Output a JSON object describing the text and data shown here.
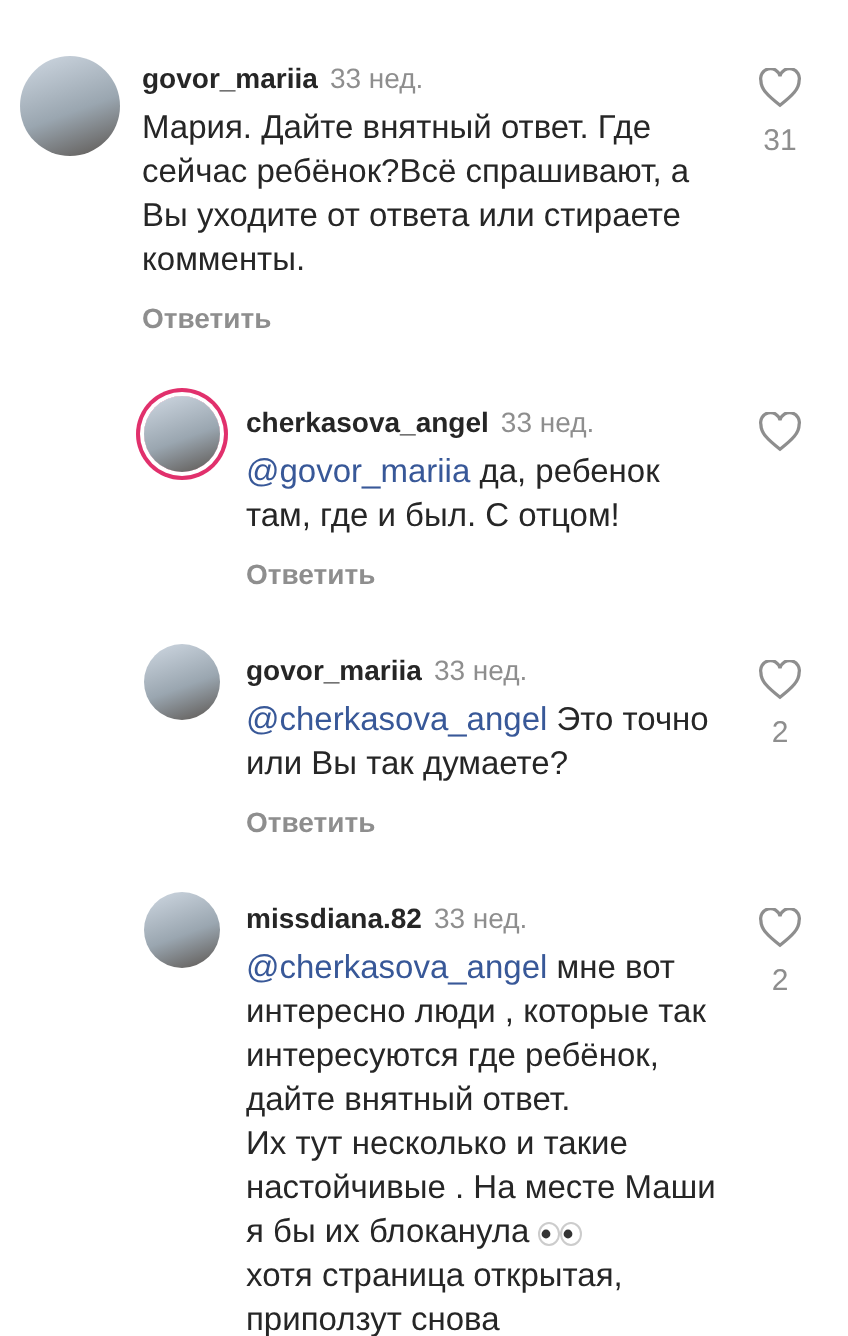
{
  "comments": [
    {
      "username": "govor_mariia",
      "time": "33 нед.",
      "story_ring": false,
      "reply": false,
      "segments": [
        {
          "kind": "text",
          "text": "Мария. Дайте внятный ответ. Где сейчас ребёнок?Всё спрашивают, а Вы уходите от ответа или стираете комменты."
        }
      ],
      "likes": "31",
      "action": "Ответить"
    },
    {
      "username": "cherkasova_angel",
      "time": "33 нед.",
      "story_ring": true,
      "reply": true,
      "segments": [
        {
          "kind": "mention",
          "text": "@govor_mariia"
        },
        {
          "kind": "text",
          "text": " да, ребенок там, где и был. С отцом!"
        }
      ],
      "action": "Ответить"
    },
    {
      "username": "govor_mariia",
      "time": "33 нед.",
      "story_ring": false,
      "reply": true,
      "segments": [
        {
          "kind": "mention",
          "text": "@cherkasova_angel"
        },
        {
          "kind": "text",
          "text": " Это точно или Вы так думаете?"
        }
      ],
      "likes": "2",
      "action": "Ответить"
    },
    {
      "username": "missdiana.82",
      "time": "33 нед.",
      "story_ring": false,
      "reply": true,
      "segments": [
        {
          "kind": "mention",
          "text": "@cherkasova_angel"
        },
        {
          "kind": "text",
          "text": " мне вот интересно люди , которые так интересуются где ребёнок, дайте  внятный ответ.\nИх тут несколько и такие настойчивые . На месте Маши я бы их блоканула "
        },
        {
          "kind": "emoji"
        },
        {
          "kind": "text",
          "text": "\nхотя страница открытая, приползут снова"
        }
      ],
      "likes": "2"
    }
  ]
}
